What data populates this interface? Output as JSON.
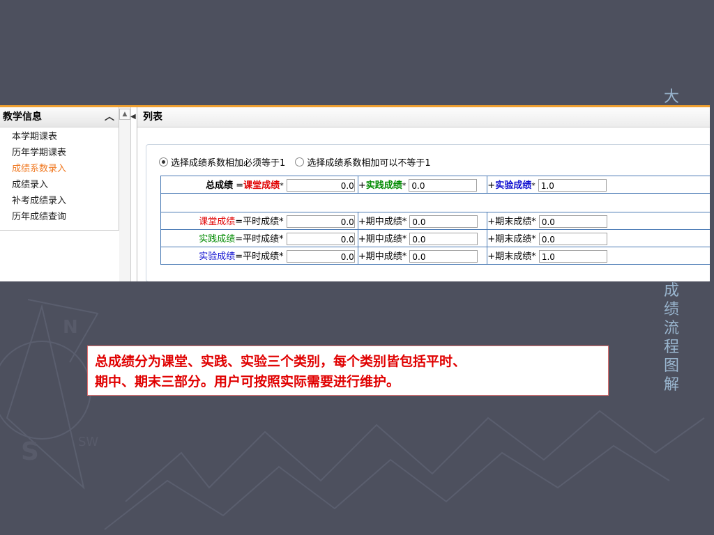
{
  "slide": {
    "vertical_title_top": "大",
    "vertical_title_bottom": [
      "成",
      "绩",
      "流",
      "程",
      "图",
      "解"
    ]
  },
  "sidebar": {
    "header": "教学信息",
    "items": [
      {
        "label": "本学期课表",
        "active": false
      },
      {
        "label": "历年学期课表",
        "active": false
      },
      {
        "label": "成绩系数录入",
        "active": true
      },
      {
        "label": "成绩录入",
        "active": false
      },
      {
        "label": "补考成绩录入",
        "active": false
      },
      {
        "label": "历年成绩查询",
        "active": false
      }
    ]
  },
  "main": {
    "header": "列表",
    "radio_options": [
      {
        "label": "选择成绩系数相加必须等于1",
        "checked": true
      },
      {
        "label": "选择成绩系数相加可以不等于1",
        "checked": false
      }
    ],
    "total_row": {
      "label": "总成绩",
      "eq": "=",
      "classroom_label": "课堂成绩",
      "classroom_value": "0.0",
      "practice_label": "实践成绩",
      "practice_value": "0.0",
      "experiment_label": "实验成绩",
      "experiment_value": "1.0",
      "plus": "+",
      "star": "*"
    },
    "rows": [
      {
        "category": "课堂成绩",
        "color": "#e00000",
        "usual": "0.0",
        "mid": "0.0",
        "final": "0.0"
      },
      {
        "category": "实践成绩",
        "color": "#008a00",
        "usual": "0.0",
        "mid": "0.0",
        "final": "0.0"
      },
      {
        "category": "实验成绩",
        "color": "#1010d0",
        "usual": "0.0",
        "mid": "0.0",
        "final": "1.0"
      }
    ],
    "formula_labels": {
      "usual": "=平时成绩*",
      "mid": "+期中成绩*",
      "final": "+期末成绩*"
    }
  },
  "note": {
    "line1": "总成绩分为课堂、实践、实验三个类别，每个类别皆包括平时、",
    "line2": "期中、期末三部分。用户可按照实际需要进行维护。"
  }
}
